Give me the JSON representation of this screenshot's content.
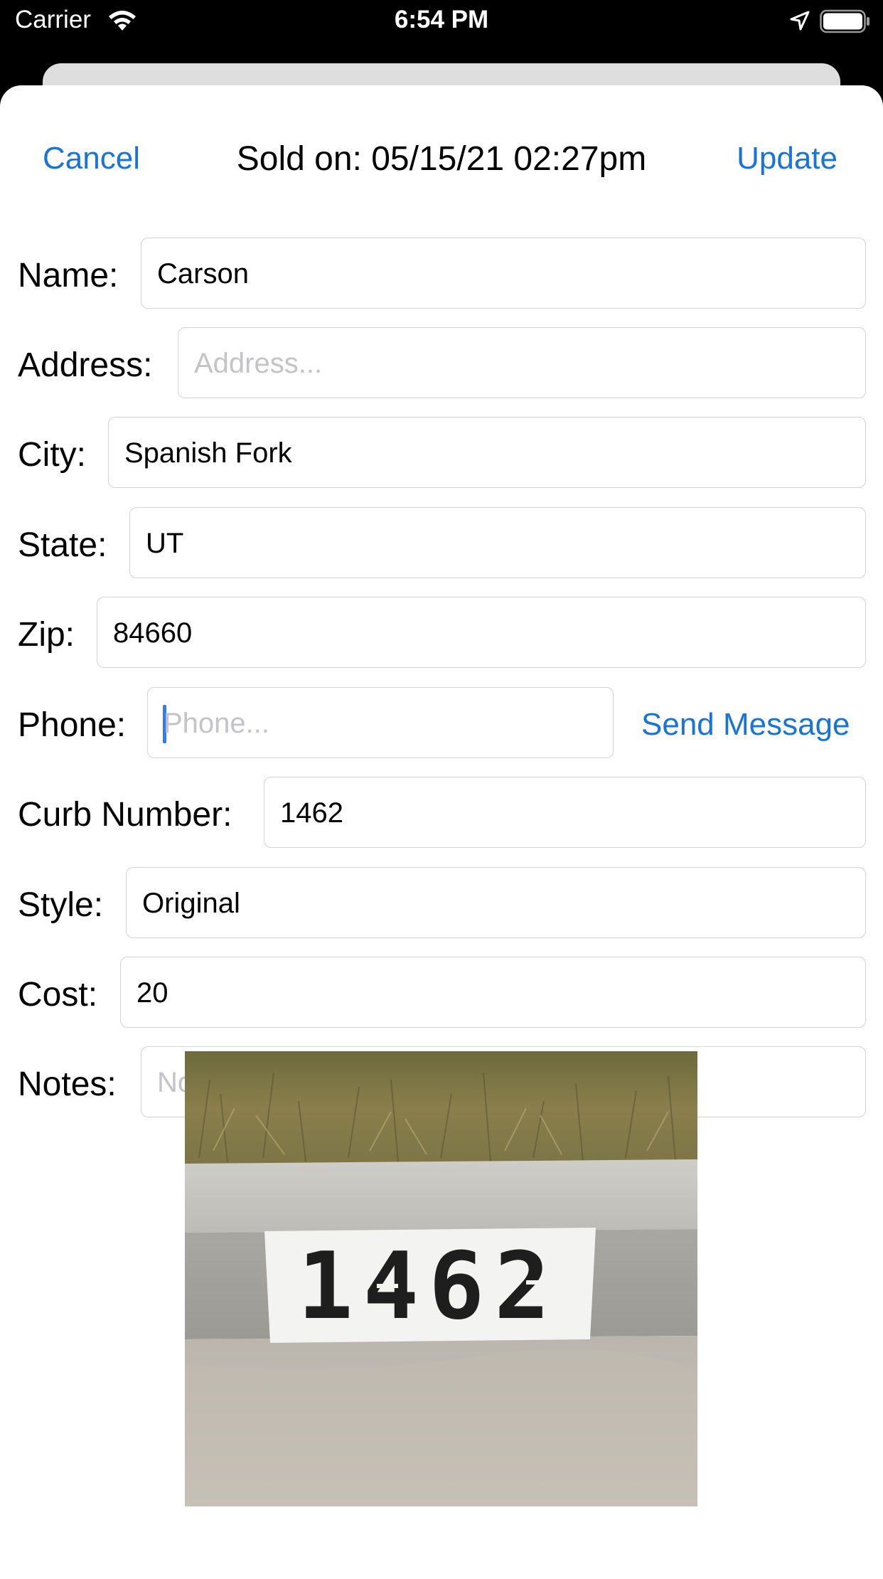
{
  "status_bar": {
    "carrier": "Carrier",
    "time": "6:54 PM",
    "icons": [
      "wifi-icon",
      "location-arrow-icon",
      "battery-icon"
    ]
  },
  "nav": {
    "cancel_label": "Cancel",
    "title": "Sold on: 05/15/21 02:27pm",
    "update_label": "Update"
  },
  "form": {
    "name": {
      "label": "Name:",
      "value": "Carson"
    },
    "address": {
      "label": "Address:",
      "placeholder": "Address..."
    },
    "city": {
      "label": "City:",
      "value": "Spanish Fork"
    },
    "state": {
      "label": "State:",
      "value": "UT"
    },
    "zip": {
      "label": "Zip:",
      "value": "84660"
    },
    "phone": {
      "label": "Phone:",
      "placeholder": "Phone...",
      "action_label": "Send Message"
    },
    "curb_number": {
      "label": "Curb Number:",
      "value": "1462"
    },
    "style": {
      "label": "Style:",
      "value": "Original"
    },
    "cost": {
      "label": "Cost:",
      "value": "20"
    },
    "notes": {
      "label": "Notes:",
      "placeholder": "Notes..."
    }
  },
  "photo": {
    "painted_number": "1462"
  },
  "colors": {
    "accent": "#1a73d9",
    "cursor": "#3478f6",
    "placeholder": "#c3c3c8",
    "field_border": "#d3d3d6"
  }
}
